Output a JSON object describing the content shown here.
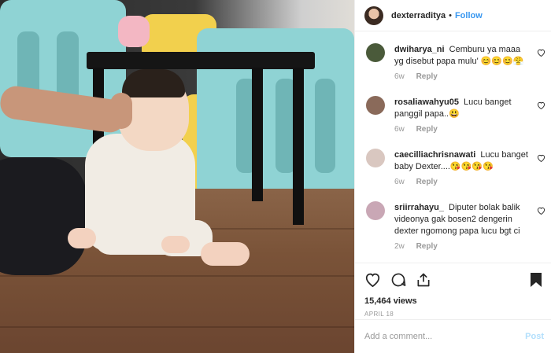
{
  "header": {
    "username": "dexterraditya",
    "separator": "•",
    "follow_label": "Follow"
  },
  "comments": [
    {
      "username": "dwiharya_ni",
      "text": "Cemburu ya maaa yg disebut papa mulu' 😊😊😊😤",
      "age": "6w",
      "reply_label": "Reply",
      "avatar_color": "#4a5a3a"
    },
    {
      "username": "rosaliawahyu05",
      "text": "Lucu banget panggil papa..😃",
      "age": "6w",
      "reply_label": "Reply",
      "avatar_color": "#8a6a5a"
    },
    {
      "username": "caecilliachrisnawati",
      "text": "Lucu banget baby Dexter....😘😘😘😘",
      "age": "6w",
      "reply_label": "Reply",
      "avatar_color": "#d9c7c0"
    },
    {
      "username": "sriirrahayu_",
      "text": "Diputer bolak balik videonya gak bosen2 dengerin dexter ngomong papa lucu bgt ci",
      "age": "2w",
      "reply_label": "Reply",
      "avatar_color": "#c9a7b5"
    }
  ],
  "post": {
    "views": "15,464 views",
    "date": "APRIL 18"
  },
  "add_comment": {
    "placeholder": "Add a comment...",
    "post_label": "Post"
  },
  "icons": [
    "heart-icon",
    "comment-icon",
    "share-icon",
    "bookmark-icon",
    "small-heart-icon"
  ],
  "colors": {
    "accent": "#3897f0",
    "post_disabled": "#b2dffc",
    "muted": "#999999",
    "text": "#262626"
  }
}
